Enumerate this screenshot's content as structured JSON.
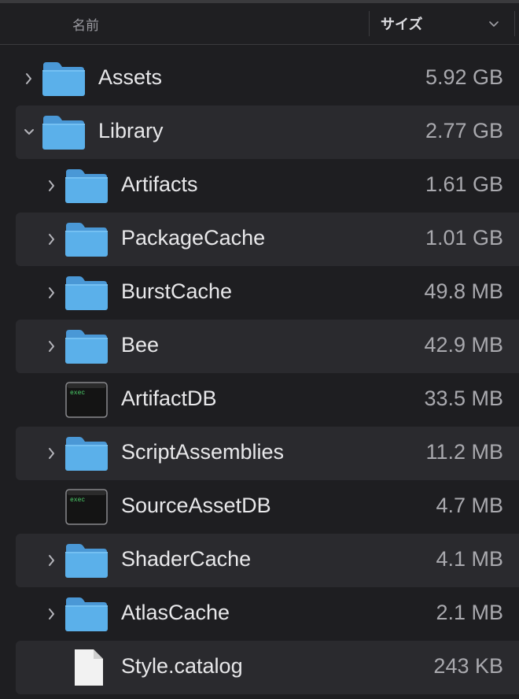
{
  "header": {
    "name_label": "名前",
    "size_label": "サイズ",
    "sort_icon": "chevron-down-icon"
  },
  "colors": {
    "background": "#1e1e21",
    "row_alt": "#2a2a2e",
    "folder_blue": "#5bb0ea",
    "text": "#e8e8ea",
    "size_text": "#a9a9ae"
  },
  "rows": [
    {
      "name": "Assets",
      "size": "5.92 GB",
      "icon": "folder-icon",
      "disclosure": "chevron-right-icon",
      "level": 0
    },
    {
      "name": "Library",
      "size": "2.77 GB",
      "icon": "folder-icon",
      "disclosure": "chevron-down-icon",
      "level": 0
    },
    {
      "name": "Artifacts",
      "size": "1.61 GB",
      "icon": "folder-icon",
      "disclosure": "chevron-right-icon",
      "level": 1
    },
    {
      "name": "PackageCache",
      "size": "1.01 GB",
      "icon": "folder-icon",
      "disclosure": "chevron-right-icon",
      "level": 1
    },
    {
      "name": "BurstCache",
      "size": "49.8 MB",
      "icon": "folder-icon",
      "disclosure": "chevron-right-icon",
      "level": 1
    },
    {
      "name": "Bee",
      "size": "42.9 MB",
      "icon": "folder-icon",
      "disclosure": "chevron-right-icon",
      "level": 1
    },
    {
      "name": "ArtifactDB",
      "size": "33.5 MB",
      "icon": "exec-file-icon",
      "exec_label": "exec",
      "level": 1
    },
    {
      "name": "ScriptAssemblies",
      "size": "11.2 MB",
      "icon": "folder-icon",
      "disclosure": "chevron-right-icon",
      "level": 1
    },
    {
      "name": "SourceAssetDB",
      "size": "4.7 MB",
      "icon": "exec-file-icon",
      "exec_label": "exec",
      "level": 1
    },
    {
      "name": "ShaderCache",
      "size": "4.1 MB",
      "icon": "folder-icon",
      "disclosure": "chevron-right-icon",
      "level": 1
    },
    {
      "name": "AtlasCache",
      "size": "2.1 MB",
      "icon": "folder-icon",
      "disclosure": "chevron-right-icon",
      "level": 1
    },
    {
      "name": "Style.catalog",
      "size": "243 KB",
      "icon": "document-icon",
      "level": 1
    }
  ]
}
